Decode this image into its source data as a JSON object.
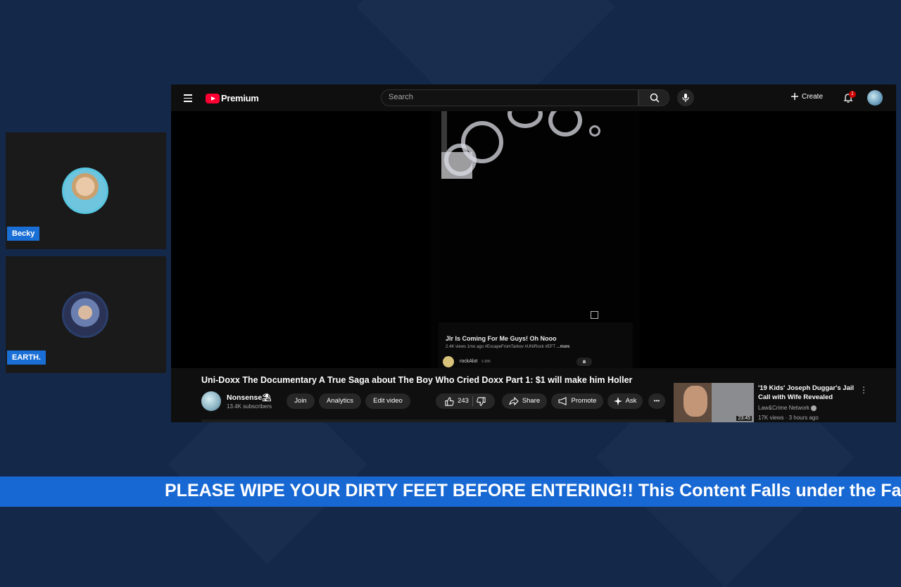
{
  "participants": [
    {
      "name": "Becky"
    },
    {
      "name": "EARTH."
    }
  ],
  "youtube": {
    "logo_text": "Premium",
    "search_placeholder": "Search",
    "create_label": "Create",
    "notification_count": "1",
    "shorts": {
      "title": "Jlr Is Coming For Me Guys! Oh Nooo",
      "meta": "2.4K views  1mo ago  #EscapeFromTarkov #UNIRock #EFT",
      "more_label": "...more",
      "channel": "rockAlot",
      "channel_subs": "6.88K",
      "progress": 0.3
    },
    "video": {
      "title": "Uni-Doxx The Documentary A True Saga about The Boy Who Cried Doxx Part 1: $1 will make him Holler",
      "channel_name": "Nonsense⛱",
      "subscribers": "13.4K subscribers",
      "join_label": "Join",
      "analytics_label": "Analytics",
      "edit_label": "Edit video",
      "likes": "243",
      "share_label": "Share",
      "promote_label": "Promote",
      "ask_label": "Ask",
      "more_label": "•••"
    },
    "recommendation": {
      "title": "'19 Kids' Joseph Duggar's Jail Call with Wife Revealed",
      "channel": "Law&Crime Network",
      "meta": "17K views · 3 hours ago",
      "duration": "23:45",
      "menu": "⋮"
    }
  },
  "ticker": {
    "text": "PLEASE WIPE YOUR DIRTY FEET BEFORE ENTERING!! This Content Falls under the Fai"
  },
  "colors": {
    "background": "#14284a",
    "name_tag": "#1a6fd6",
    "ticker": "#1868d3",
    "youtube_red": "#ff0033"
  }
}
